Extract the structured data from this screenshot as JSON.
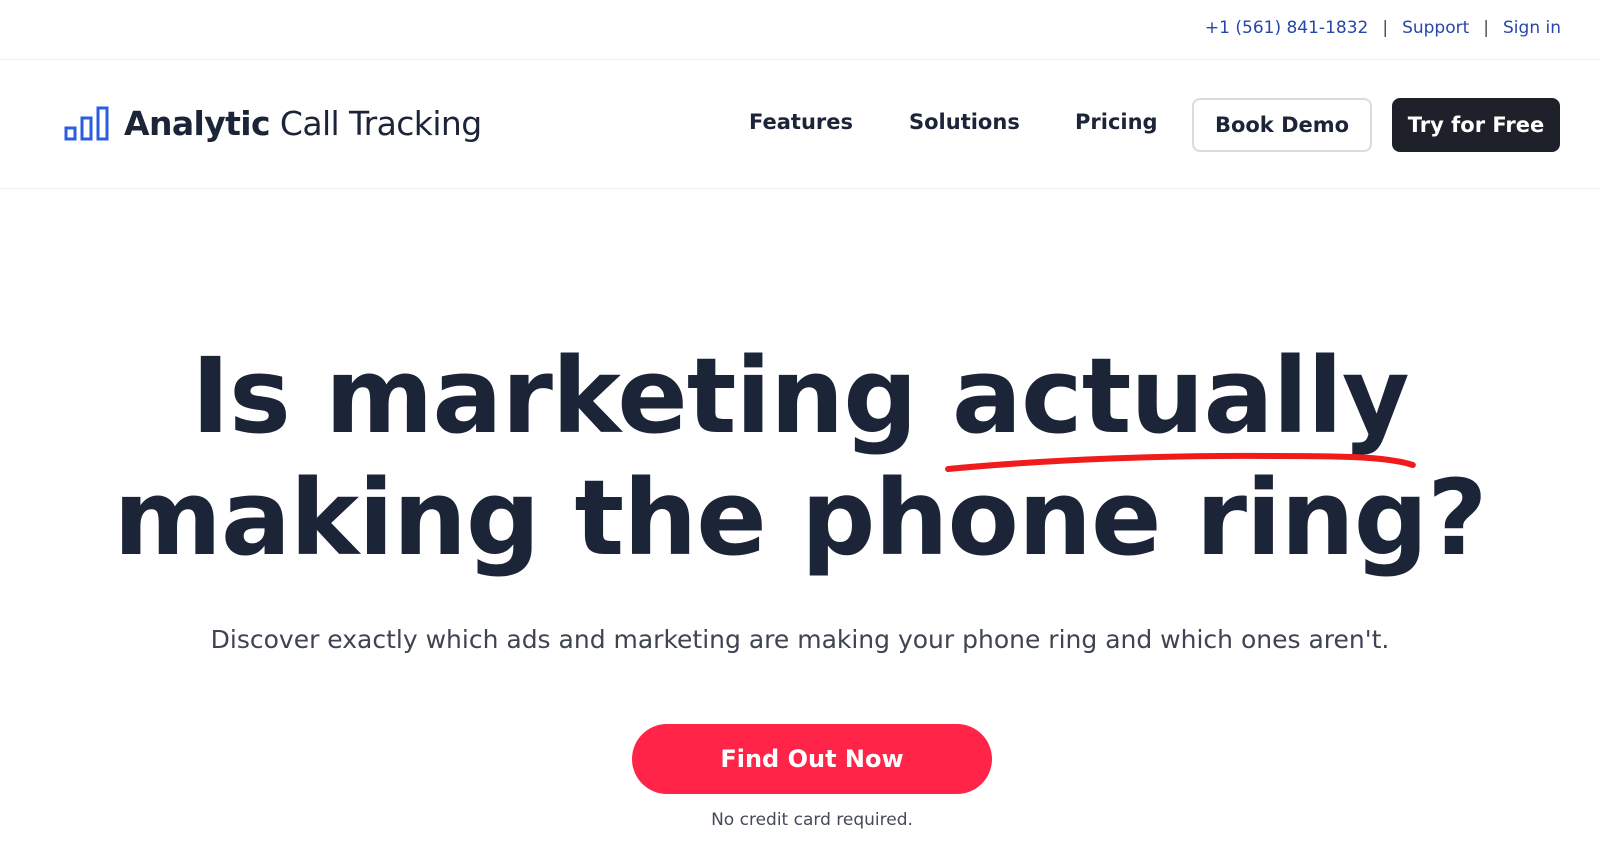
{
  "topbar": {
    "phone": "+1 (561) 841-1832",
    "separator": "|",
    "support": "Support",
    "sign_in": "Sign in"
  },
  "header": {
    "logo_icon": "bar-chart-icon",
    "logo_bold": "Analytic",
    "logo_light": "Call Tracking",
    "nav": [
      "Features",
      "Solutions",
      "Pricing"
    ],
    "book_demo": "Book Demo",
    "try_free": "Try for Free"
  },
  "hero": {
    "title_part1": "Is marketing",
    "title_highlight": "actually",
    "title_line2": "making the phone ring?",
    "subtitle": "Discover exactly which ads and marketing are making your phone ring and which ones aren't.",
    "cta": "Find Out Now",
    "cta_note": "No credit card required."
  },
  "colors": {
    "text_dark": "#1c2438",
    "link_blue": "#2747a8",
    "logo_blue": "#2b5de0",
    "cta_red": "#ff2448",
    "underline_red": "#f01c1c",
    "button_dark": "#1e2129"
  }
}
